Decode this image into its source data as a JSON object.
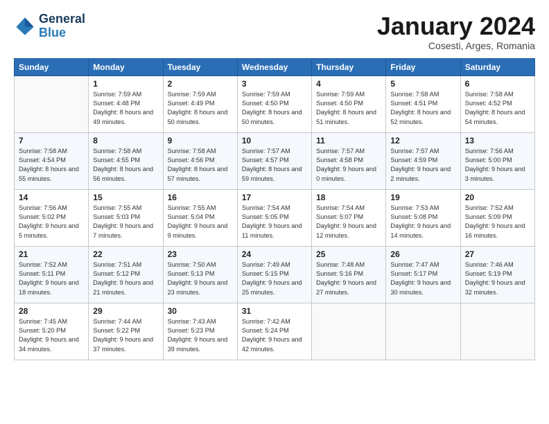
{
  "logo": {
    "text_general": "General",
    "text_blue": "Blue"
  },
  "title": "January 2024",
  "location": "Cosesti, Arges, Romania",
  "days_header": [
    "Sunday",
    "Monday",
    "Tuesday",
    "Wednesday",
    "Thursday",
    "Friday",
    "Saturday"
  ],
  "weeks": [
    [
      {
        "num": "",
        "sunrise": "",
        "sunset": "",
        "daylight": ""
      },
      {
        "num": "1",
        "sunrise": "Sunrise: 7:59 AM",
        "sunset": "Sunset: 4:48 PM",
        "daylight": "Daylight: 8 hours and 49 minutes."
      },
      {
        "num": "2",
        "sunrise": "Sunrise: 7:59 AM",
        "sunset": "Sunset: 4:49 PM",
        "daylight": "Daylight: 8 hours and 50 minutes."
      },
      {
        "num": "3",
        "sunrise": "Sunrise: 7:59 AM",
        "sunset": "Sunset: 4:50 PM",
        "daylight": "Daylight: 8 hours and 50 minutes."
      },
      {
        "num": "4",
        "sunrise": "Sunrise: 7:59 AM",
        "sunset": "Sunset: 4:50 PM",
        "daylight": "Daylight: 8 hours and 51 minutes."
      },
      {
        "num": "5",
        "sunrise": "Sunrise: 7:58 AM",
        "sunset": "Sunset: 4:51 PM",
        "daylight": "Daylight: 8 hours and 52 minutes."
      },
      {
        "num": "6",
        "sunrise": "Sunrise: 7:58 AM",
        "sunset": "Sunset: 4:52 PM",
        "daylight": "Daylight: 8 hours and 54 minutes."
      }
    ],
    [
      {
        "num": "7",
        "sunrise": "Sunrise: 7:58 AM",
        "sunset": "Sunset: 4:54 PM",
        "daylight": "Daylight: 8 hours and 55 minutes."
      },
      {
        "num": "8",
        "sunrise": "Sunrise: 7:58 AM",
        "sunset": "Sunset: 4:55 PM",
        "daylight": "Daylight: 8 hours and 56 minutes."
      },
      {
        "num": "9",
        "sunrise": "Sunrise: 7:58 AM",
        "sunset": "Sunset: 4:56 PM",
        "daylight": "Daylight: 8 hours and 57 minutes."
      },
      {
        "num": "10",
        "sunrise": "Sunrise: 7:57 AM",
        "sunset": "Sunset: 4:57 PM",
        "daylight": "Daylight: 8 hours and 59 minutes."
      },
      {
        "num": "11",
        "sunrise": "Sunrise: 7:57 AM",
        "sunset": "Sunset: 4:58 PM",
        "daylight": "Daylight: 9 hours and 0 minutes."
      },
      {
        "num": "12",
        "sunrise": "Sunrise: 7:57 AM",
        "sunset": "Sunset: 4:59 PM",
        "daylight": "Daylight: 9 hours and 2 minutes."
      },
      {
        "num": "13",
        "sunrise": "Sunrise: 7:56 AM",
        "sunset": "Sunset: 5:00 PM",
        "daylight": "Daylight: 9 hours and 3 minutes."
      }
    ],
    [
      {
        "num": "14",
        "sunrise": "Sunrise: 7:56 AM",
        "sunset": "Sunset: 5:02 PM",
        "daylight": "Daylight: 9 hours and 5 minutes."
      },
      {
        "num": "15",
        "sunrise": "Sunrise: 7:55 AM",
        "sunset": "Sunset: 5:03 PM",
        "daylight": "Daylight: 9 hours and 7 minutes."
      },
      {
        "num": "16",
        "sunrise": "Sunrise: 7:55 AM",
        "sunset": "Sunset: 5:04 PM",
        "daylight": "Daylight: 9 hours and 9 minutes."
      },
      {
        "num": "17",
        "sunrise": "Sunrise: 7:54 AM",
        "sunset": "Sunset: 5:05 PM",
        "daylight": "Daylight: 9 hours and 11 minutes."
      },
      {
        "num": "18",
        "sunrise": "Sunrise: 7:54 AM",
        "sunset": "Sunset: 5:07 PM",
        "daylight": "Daylight: 9 hours and 12 minutes."
      },
      {
        "num": "19",
        "sunrise": "Sunrise: 7:53 AM",
        "sunset": "Sunset: 5:08 PM",
        "daylight": "Daylight: 9 hours and 14 minutes."
      },
      {
        "num": "20",
        "sunrise": "Sunrise: 7:52 AM",
        "sunset": "Sunset: 5:09 PM",
        "daylight": "Daylight: 9 hours and 16 minutes."
      }
    ],
    [
      {
        "num": "21",
        "sunrise": "Sunrise: 7:52 AM",
        "sunset": "Sunset: 5:11 PM",
        "daylight": "Daylight: 9 hours and 18 minutes."
      },
      {
        "num": "22",
        "sunrise": "Sunrise: 7:51 AM",
        "sunset": "Sunset: 5:12 PM",
        "daylight": "Daylight: 9 hours and 21 minutes."
      },
      {
        "num": "23",
        "sunrise": "Sunrise: 7:50 AM",
        "sunset": "Sunset: 5:13 PM",
        "daylight": "Daylight: 9 hours and 23 minutes."
      },
      {
        "num": "24",
        "sunrise": "Sunrise: 7:49 AM",
        "sunset": "Sunset: 5:15 PM",
        "daylight": "Daylight: 9 hours and 25 minutes."
      },
      {
        "num": "25",
        "sunrise": "Sunrise: 7:48 AM",
        "sunset": "Sunset: 5:16 PM",
        "daylight": "Daylight: 9 hours and 27 minutes."
      },
      {
        "num": "26",
        "sunrise": "Sunrise: 7:47 AM",
        "sunset": "Sunset: 5:17 PM",
        "daylight": "Daylight: 9 hours and 30 minutes."
      },
      {
        "num": "27",
        "sunrise": "Sunrise: 7:46 AM",
        "sunset": "Sunset: 5:19 PM",
        "daylight": "Daylight: 9 hours and 32 minutes."
      }
    ],
    [
      {
        "num": "28",
        "sunrise": "Sunrise: 7:45 AM",
        "sunset": "Sunset: 5:20 PM",
        "daylight": "Daylight: 9 hours and 34 minutes."
      },
      {
        "num": "29",
        "sunrise": "Sunrise: 7:44 AM",
        "sunset": "Sunset: 5:22 PM",
        "daylight": "Daylight: 9 hours and 37 minutes."
      },
      {
        "num": "30",
        "sunrise": "Sunrise: 7:43 AM",
        "sunset": "Sunset: 5:23 PM",
        "daylight": "Daylight: 9 hours and 39 minutes."
      },
      {
        "num": "31",
        "sunrise": "Sunrise: 7:42 AM",
        "sunset": "Sunset: 5:24 PM",
        "daylight": "Daylight: 9 hours and 42 minutes."
      },
      {
        "num": "",
        "sunrise": "",
        "sunset": "",
        "daylight": ""
      },
      {
        "num": "",
        "sunrise": "",
        "sunset": "",
        "daylight": ""
      },
      {
        "num": "",
        "sunrise": "",
        "sunset": "",
        "daylight": ""
      }
    ]
  ]
}
